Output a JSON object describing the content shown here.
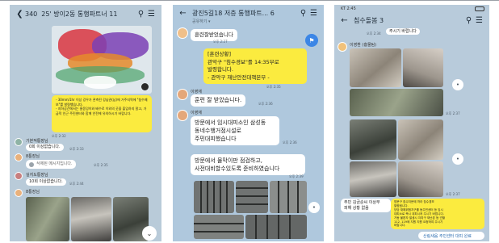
{
  "screen1": {
    "header": {
      "back_count": "340",
      "title": "25' 방이2동 통행파트너 11"
    },
    "alert_text": "- 30mm/1hr 이상 강우가 관측된 강남권(남)에 거주지역에 \"침수예보\"를 발령했습니다.\n- 지하공간에서는 물웅덩이와 배수로 이외의 곳을 출입하지 말고, 가급적 인근 주민센터와 함께 안전에 유의하시기 바랍니다.",
    "alert_time": "오후 2:32",
    "msg1_name": "기본적통장님",
    "msg1_text": "0회 이상없습니다.",
    "msg1_time": "오후 2:33",
    "msg2_name": "8통장님",
    "msg2_text": "삭제된 메시지입니다.",
    "msg2_time": "오후 2:35",
    "msg3_name": "실지도통장님",
    "msg3_text": "10회 이상없습니다.",
    "msg3_time": "오후 2:44",
    "msg4_name": "8통장님"
  },
  "screen2": {
    "header": {
      "title": "광진5길18 저층 통행파트... 6",
      "subtitle": "공유하기 ▾"
    },
    "bubble_top": "훈련잘받었습니다",
    "bubble_top_time": "오후 2:27",
    "notice_text": "[훈련상황]\n관악구 \"침수경보\"를 14:35부로\n발령합니다.\n- 관악구 재난안전대책본부 -",
    "notice_time": "오후 2:35",
    "sender_a": "이영재",
    "msg_a": "훈련 잘 받았습니다.",
    "msg_a_time": "오후 2:36",
    "sender_b": "이영재",
    "msg_b": "방문에서 임시대피소인 삼성동\n동네수행거점시설로\n주민대피했습니다",
    "msg_b_time": "오후 2:36",
    "msg_c": "방문에서 물막이판 점검하고,\n사전대비할수있도록 준비하였습니다",
    "msg_c_time": "오후 2:39"
  },
  "screen3": {
    "status": "KT 2:45",
    "header": {
      "title": "침수돌봄 3"
    },
    "top_text": "주시기 바랍니다",
    "top_time": "오후 2:34",
    "sender": "이영환 (흥물팀)",
    "photo1_time": "오후 2:37",
    "photo2_time": "오후 2:37",
    "reply_text": "주민 김금순씨 이상무\n피해 상황 없음",
    "reply_time": "오후 2:43",
    "yellow_text": "방문구 침수처문에 따라 침수경보\n발령됩니다.\n당당 재해위험지구를 동주민센터 등 임시\n대피소로 즉시 대피시켜 주시기 바랍니다.\n거동 불편자 발생시 자치구 재난본 등 관할\n112, 119에 지원 지원 요청하여 주시기\n바랍니다.",
    "bottom_bar": "산림새움 주민센터 대피 완료"
  }
}
